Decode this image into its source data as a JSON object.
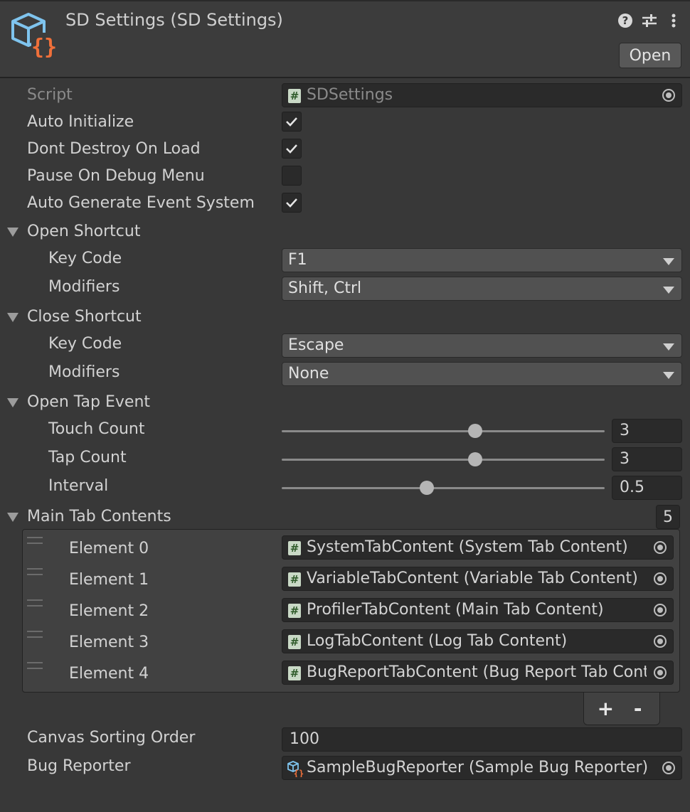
{
  "header": {
    "title": "SD Settings (SD Settings)",
    "open_button": "Open",
    "icons": [
      "help-icon",
      "preset-icon",
      "more-menu-icon"
    ]
  },
  "script_field": {
    "label": "Script",
    "value": "SDSettings"
  },
  "toggles": [
    {
      "label": "Auto Initialize",
      "checked": true
    },
    {
      "label": "Dont Destroy On Load",
      "checked": true
    },
    {
      "label": "Pause On Debug Menu",
      "checked": false
    },
    {
      "label": "Auto Generate Event System",
      "checked": true
    }
  ],
  "open_shortcut": {
    "label": "Open Shortcut",
    "key_code_label": "Key Code",
    "key_code": "F1",
    "modifiers_label": "Modifiers",
    "modifiers": "Shift, Ctrl"
  },
  "close_shortcut": {
    "label": "Close Shortcut",
    "key_code_label": "Key Code",
    "key_code": "Escape",
    "modifiers_label": "Modifiers",
    "modifiers": "None"
  },
  "open_tap_event": {
    "label": "Open Tap Event",
    "touch_count": {
      "label": "Touch Count",
      "value": "3",
      "fraction": 0.6
    },
    "tap_count": {
      "label": "Tap Count",
      "value": "3",
      "fraction": 0.6
    },
    "interval": {
      "label": "Interval",
      "value": "0.5",
      "fraction": 0.45
    }
  },
  "main_tab_contents": {
    "label": "Main Tab Contents",
    "size": "5",
    "elements": [
      {
        "label": "Element 0",
        "value": "SystemTabContent (System Tab Content)"
      },
      {
        "label": "Element 1",
        "value": "VariableTabContent (Variable Tab Content)"
      },
      {
        "label": "Element 2",
        "value": "ProfilerTabContent (Main Tab Content)"
      },
      {
        "label": "Element 3",
        "value": "LogTabContent (Log Tab Content)"
      },
      {
        "label": "Element 4",
        "value": "BugReportTabContent (Bug Report Tab Content)"
      }
    ],
    "add_label": "+",
    "remove_label": "-"
  },
  "canvas_sorting_order": {
    "label": "Canvas Sorting Order",
    "value": "100"
  },
  "bug_reporter": {
    "label": "Bug Reporter",
    "value": "SampleBugReporter (Sample Bug Reporter)"
  }
}
